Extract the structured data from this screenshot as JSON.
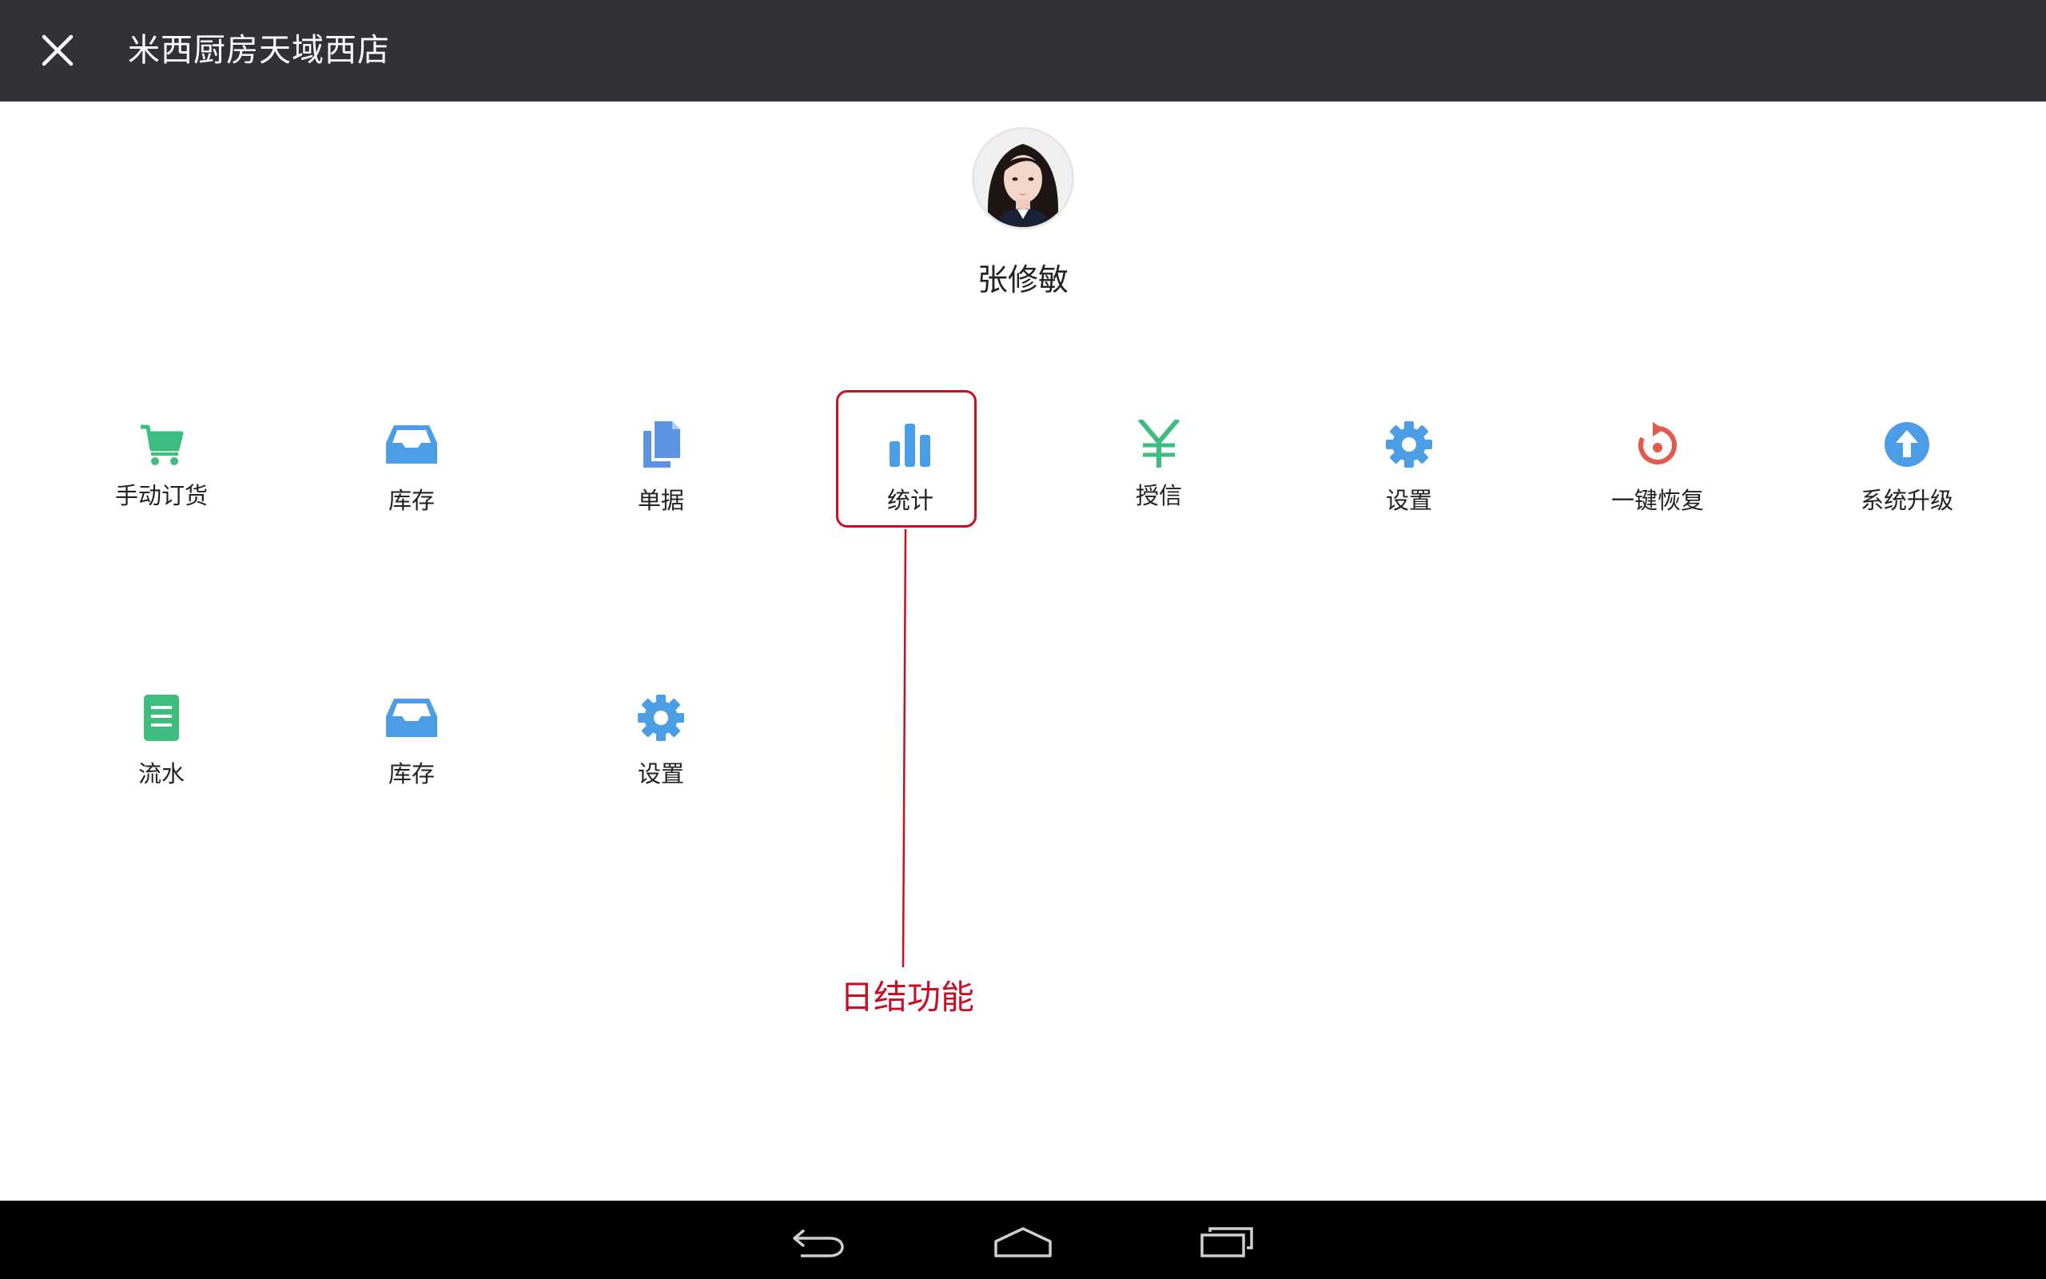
{
  "header": {
    "title": "米西厨房天域西店",
    "close_icon": "close-icon"
  },
  "profile": {
    "name": "张修敏",
    "avatar": "user-avatar-photo"
  },
  "menu_row1": [
    {
      "label": "手动订货",
      "icon": "cart-icon",
      "color": "#3dbd80"
    },
    {
      "label": "库存",
      "icon": "inbox-tray-icon",
      "color": "#4b9ee6"
    },
    {
      "label": "单据",
      "icon": "documents-icon",
      "color": "#5b94e2"
    },
    {
      "label": "统计",
      "icon": "bar-chart-icon",
      "color": "#4b9ee6"
    },
    {
      "label": "授信",
      "icon": "yen-icon",
      "color": "#3dbd80"
    },
    {
      "label": "设置",
      "icon": "gear-icon",
      "color": "#4b9ee6"
    },
    {
      "label": "一键恢复",
      "icon": "restore-icon",
      "color": "#e35a4c"
    },
    {
      "label": "系统升级",
      "icon": "upgrade-arrow-icon",
      "color": "#4b9ee6"
    }
  ],
  "menu_row2": [
    {
      "label": "流水",
      "icon": "ledger-icon",
      "color": "#3dbd80"
    },
    {
      "label": "库存",
      "icon": "inbox-tray-icon",
      "color": "#4b9ee6"
    },
    {
      "label": "设置",
      "icon": "gear-icon",
      "color": "#4b9ee6"
    }
  ],
  "annotation": {
    "text": "日结功能",
    "color": "#c80f24"
  },
  "system_nav": {
    "back_icon": "back-icon",
    "home_icon": "home-icon",
    "recents_icon": "recents-icon"
  },
  "colors": {
    "topbar": "#323137",
    "navbar": "#000000",
    "accent_green": "#3dbd80",
    "accent_blue": "#4b9ee6",
    "accent_red": "#e35a4c",
    "annotation_red": "#c80f24"
  }
}
